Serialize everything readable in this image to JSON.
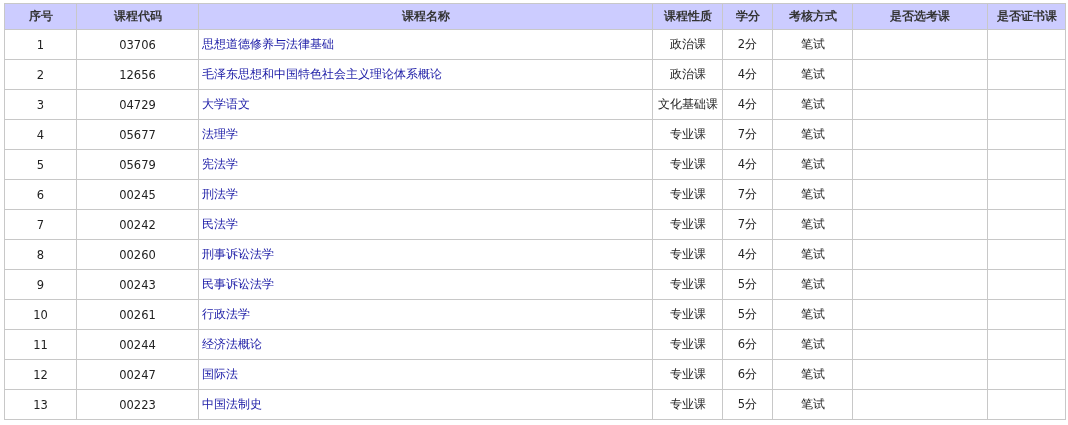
{
  "table": {
    "columns": [
      "序号",
      "课程代码",
      "课程名称",
      "课程性质",
      "学分",
      "考核方式",
      "是否选考课",
      "是否证书课"
    ],
    "rows": [
      {
        "index": "1",
        "code": "03706",
        "name": "思想道德修养与法律基础",
        "type": "政治课",
        "credits": "2分",
        "exam": "笔试"
      },
      {
        "index": "2",
        "code": "12656",
        "name": "毛泽东思想和中国特色社会主义理论体系概论",
        "type": "政治课",
        "credits": "4分",
        "exam": "笔试"
      },
      {
        "index": "3",
        "code": "04729",
        "name": "大学语文",
        "type": "文化基础课",
        "credits": "4分",
        "exam": "笔试"
      },
      {
        "index": "4",
        "code": "05677",
        "name": "法理学",
        "type": "专业课",
        "credits": "7分",
        "exam": "笔试"
      },
      {
        "index": "5",
        "code": "05679",
        "name": "宪法学",
        "type": "专业课",
        "credits": "4分",
        "exam": "笔试"
      },
      {
        "index": "6",
        "code": "00245",
        "name": "刑法学",
        "type": "专业课",
        "credits": "7分",
        "exam": "笔试"
      },
      {
        "index": "7",
        "code": "00242",
        "name": "民法学",
        "type": "专业课",
        "credits": "7分",
        "exam": "笔试"
      },
      {
        "index": "8",
        "code": "00260",
        "name": "刑事诉讼法学",
        "type": "专业课",
        "credits": "4分",
        "exam": "笔试"
      },
      {
        "index": "9",
        "code": "00243",
        "name": "民事诉讼法学",
        "type": "专业课",
        "credits": "5分",
        "exam": "笔试"
      },
      {
        "index": "10",
        "code": "00261",
        "name": "行政法学",
        "type": "专业课",
        "credits": "5分",
        "exam": "笔试"
      },
      {
        "index": "11",
        "code": "00244",
        "name": "经济法概论",
        "type": "专业课",
        "credits": "6分",
        "exam": "笔试"
      },
      {
        "index": "12",
        "code": "00247",
        "name": "国际法",
        "type": "专业课",
        "credits": "6分",
        "exam": "笔试"
      },
      {
        "index": "13",
        "code": "00223",
        "name": "中国法制史",
        "type": "专业课",
        "credits": "5分",
        "exam": "笔试"
      }
    ]
  }
}
